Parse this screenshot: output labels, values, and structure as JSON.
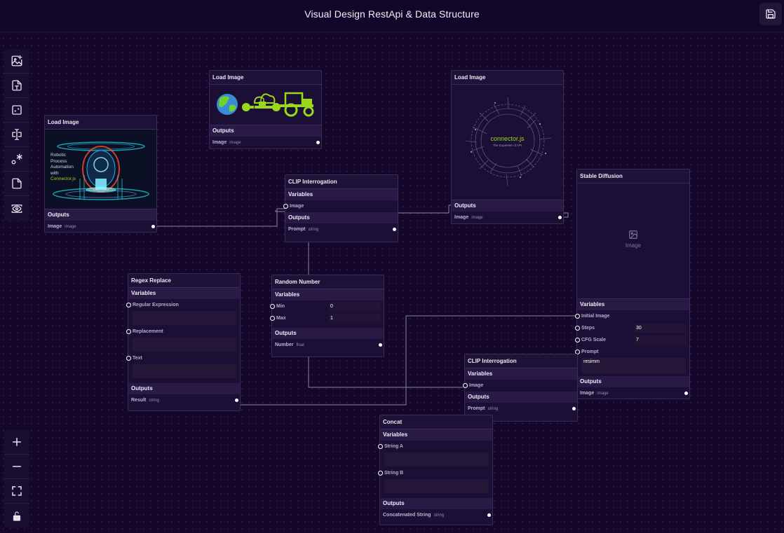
{
  "app": {
    "title": "Visual Design RestApi & Data Structure"
  },
  "toolbar_top": [
    "add-image-icon",
    "add-text-icon",
    "random-icon",
    "text-cursor-icon",
    "regex-icon",
    "document-icon",
    "eye-icon"
  ],
  "toolbar_bottom": [
    "plus-icon",
    "minus-icon",
    "fit-view-icon",
    "lock-icon"
  ],
  "nodes": {
    "load1": {
      "title": "Load Image",
      "outputs": "Outputs",
      "out_label": "Image",
      "out_type": "image",
      "img_text": [
        "Robotic",
        "Process",
        "Automation",
        "with",
        "Connector.js"
      ]
    },
    "load2": {
      "title": "Load Image",
      "outputs": "Outputs",
      "out_label": "Image",
      "out_type": "image"
    },
    "load3": {
      "title": "Load Image",
      "outputs": "Outputs",
      "out_label": "Image",
      "out_type": "image",
      "img_title": "connector.js",
      "img_sub": "The Expander of API"
    },
    "clip1": {
      "title": "CLIP Interrogation",
      "variables": "Variables",
      "in_label": "Image",
      "outputs": "Outputs",
      "out_label": "Prompt",
      "out_type": "string"
    },
    "clip2": {
      "title": "CLIP Interrogation",
      "variables": "Variables",
      "in_label": "Image",
      "outputs": "Outputs",
      "out_label": "Prompt",
      "out_type": "string"
    },
    "sd": {
      "title": "Stable Diffusion",
      "placeholder": "Image",
      "variables": "Variables",
      "in1": "Initial Image",
      "in2": "Steps",
      "in2_val": "30",
      "in3": "CFG Scale",
      "in3_val": "7",
      "in4": "Prompt",
      "in4_val": "resimm",
      "outputs": "Outputs",
      "out_label": "Image",
      "out_type": "image"
    },
    "regex": {
      "title": "Regex Replace",
      "variables": "Variables",
      "in1": "Regular Expression",
      "in2": "Replacement",
      "in3": "Text",
      "outputs": "Outputs",
      "out_label": "Result",
      "out_type": "string"
    },
    "rand": {
      "title": "Random Number",
      "variables": "Variables",
      "in1": "Min",
      "in1_val": "0",
      "in2": "Max",
      "in2_val": "1",
      "outputs": "Outputs",
      "out_label": "Number",
      "out_type": "float"
    },
    "concat": {
      "title": "Concat",
      "variables": "Variables",
      "in1": "String A",
      "in2": "String B",
      "outputs": "Outputs",
      "out_label": "Concatenated String",
      "out_type": "string"
    }
  },
  "colors": {
    "background": "#14072a",
    "node": "#1c0f36",
    "accent": "#9ad81c",
    "wire": "#8a8494"
  }
}
